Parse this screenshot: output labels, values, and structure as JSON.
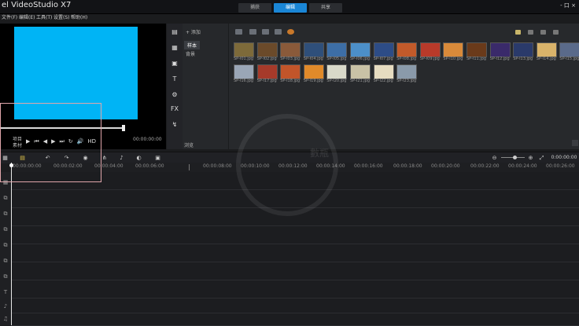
{
  "app": {
    "title": "el VideoStudio X7"
  },
  "menu": [
    "文件(F)",
    "编辑(E)",
    "工具(T)",
    "设置(S)",
    "帮助(H)"
  ],
  "step_tabs": [
    {
      "label": "捕获",
      "active": false
    },
    {
      "label": "编辑",
      "active": true
    },
    {
      "label": "共享",
      "active": false
    }
  ],
  "window_controls": "- 口 ×",
  "preview": {
    "screen_color": "#00b4f5",
    "project_label": "项目",
    "clip_label": "素材",
    "timecode": "00:00:00:00",
    "controls": [
      "▶",
      "⏮",
      "◀",
      "▶",
      "⏭",
      "↻",
      "🔊",
      "HD"
    ]
  },
  "side_tools": [
    "▤",
    "▦",
    "▣",
    "T",
    "⚙",
    "FX",
    "↯"
  ],
  "folder_panel": {
    "add_label": "+ 添加",
    "items": [
      "样本",
      "背景"
    ],
    "bottom_label": "浏览"
  },
  "thumbnails": [
    {
      "label": "SP-I01.jpg",
      "color": "#7d6a3a"
    },
    {
      "label": "SP-I02.jpg",
      "color": "#6b4a2a"
    },
    {
      "label": "SP-I03.jpg",
      "color": "#8a5a3a"
    },
    {
      "label": "SP-I04.jpg",
      "color": "#2f4f7a"
    },
    {
      "label": "SP-I05.jpg",
      "color": "#3d6ea6"
    },
    {
      "label": "SP-I06.jpg",
      "color": "#4c8fc9"
    },
    {
      "label": "SP-I07.jpg",
      "color": "#2d4c86"
    },
    {
      "label": "SP-I08.jpg",
      "color": "#c25a2a"
    },
    {
      "label": "SP-I09.jpg",
      "color": "#b83a2a"
    },
    {
      "label": "SP-I10.jpg",
      "color": "#d98a3a"
    },
    {
      "label": "SP-I11.jpg",
      "color": "#6a3a1a"
    },
    {
      "label": "SP-I12.jpg",
      "color": "#3a2a6a"
    },
    {
      "label": "SP-I13.jpg",
      "color": "#2a3a6a"
    },
    {
      "label": "SP-I14.jpg",
      "color": "#d9b36a"
    },
    {
      "label": "SP-I15.jpg",
      "color": "#5a6a8a"
    },
    {
      "label": "SP-I16.jpg",
      "color": "#9aa6b6"
    },
    {
      "label": "SP-I17.jpg",
      "color": "#a63a2a"
    },
    {
      "label": "SP-I18.jpg",
      "color": "#c2552a"
    },
    {
      "label": "SP-I19.jpg",
      "color": "#e08a2a"
    },
    {
      "label": "SP-I20.jpg",
      "color": "#d9d9c9"
    },
    {
      "label": "SP-I21.jpg",
      "color": "#c9c2a6"
    },
    {
      "label": "SP-I22.jpg",
      "color": "#e6dcc0"
    },
    {
      "label": "SP-I23.jpg",
      "color": "#8a9aaa"
    }
  ],
  "timeline": {
    "timecode": "0:00:00:00",
    "ruler_labels": [
      "00:00:00:00",
      "00:00:02:00",
      "00:00:04:00",
      "00:00:06:00",
      "00:00:08:00",
      "00:00:10:00",
      "00:00:12:00",
      "00:00:14:00",
      "00:00:16:00",
      "00:00:18:00",
      "00:00:20:00",
      "00:00:22:00",
      "00:00:24:00",
      "00:00:26:00"
    ],
    "track_icons": [
      "▦",
      "⧉",
      "⧉",
      "⧉",
      "⧉",
      "⧉",
      "⧉",
      "T",
      "♪",
      "♫"
    ]
  },
  "watermark": {
    "text": "數瓶"
  }
}
